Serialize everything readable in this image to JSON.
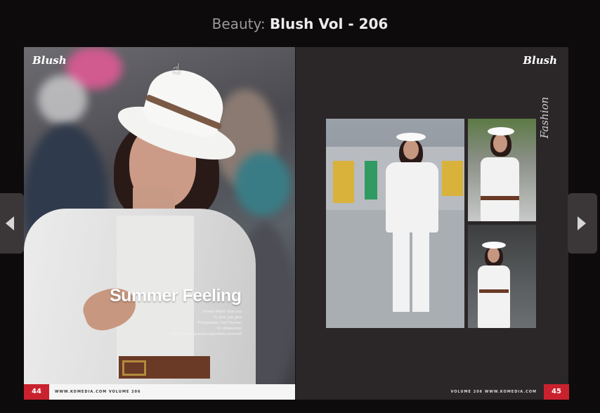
{
  "title": {
    "category": "Beauty:",
    "name": "Blush Vol - 206"
  },
  "left_page": {
    "logo": "Blush",
    "headline": "Summer Feeling",
    "credits": [
      "Female Model: Gina Just",
      "IG: gina_just_gina",
      "Photographer: Dirk Peschen",
      "IG: dirkpeschen",
      "WB: https://dirkpeschen.myportfolio.com/work"
    ],
    "page_number": "44",
    "footer": "WWW.KOMEDIA.COM     VOLUME 206"
  },
  "right_page": {
    "logo": "Blush",
    "side_label": "Fashion",
    "page_number": "45",
    "footer": "VOLUME 206     WWW.KOMEDIA.COM"
  },
  "nav": {
    "prev_icon": "chevron-left-icon",
    "next_icon": "chevron-right-icon"
  },
  "cursor_icon": "hand-pointer-icon",
  "colors": {
    "accent": "#c9222e",
    "background": "#0d0b0b",
    "title": "#ececec"
  }
}
